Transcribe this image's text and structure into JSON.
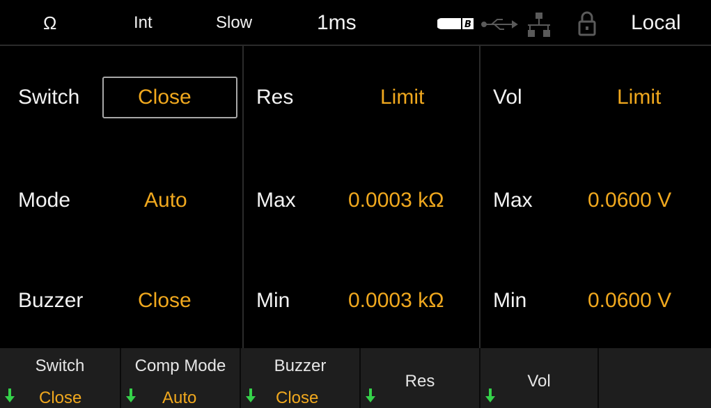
{
  "status_bar": {
    "unit": "Ω",
    "trigger": "Int",
    "speed": "Slow",
    "time": "1ms",
    "remote": "Local",
    "icons": [
      "storage-card-icon",
      "usb-icon",
      "network-icon",
      "lock-icon"
    ]
  },
  "panels": {
    "general": {
      "switch_label": "Switch",
      "switch_value": "Close",
      "mode_label": "Mode",
      "mode_value": "Auto",
      "buzzer_label": "Buzzer",
      "buzzer_value": "Close"
    },
    "resistance": {
      "title": "Res",
      "title_value": "Limit",
      "max_label": "Max",
      "max_value": "0.0003 kΩ",
      "min_label": "Min",
      "min_value": "0.0003 kΩ"
    },
    "voltage": {
      "title": "Vol",
      "title_value": "Limit",
      "max_label": "Max",
      "max_value": "0.0600 V",
      "min_label": "Min",
      "min_value": "0.0600 V"
    }
  },
  "softkeys": {
    "switch": {
      "label": "Switch",
      "value": "Close"
    },
    "comp_mode": {
      "label": "Comp Mode",
      "value": "Auto"
    },
    "buzzer": {
      "label": "Buzzer",
      "value": "Close"
    },
    "res": {
      "label": "Res"
    },
    "vol": {
      "label": "Vol"
    }
  },
  "colors": {
    "accent": "#f0a81e",
    "arrow": "#35d14a",
    "background": "#000000",
    "softkey_bg": "#1e1e1e"
  }
}
